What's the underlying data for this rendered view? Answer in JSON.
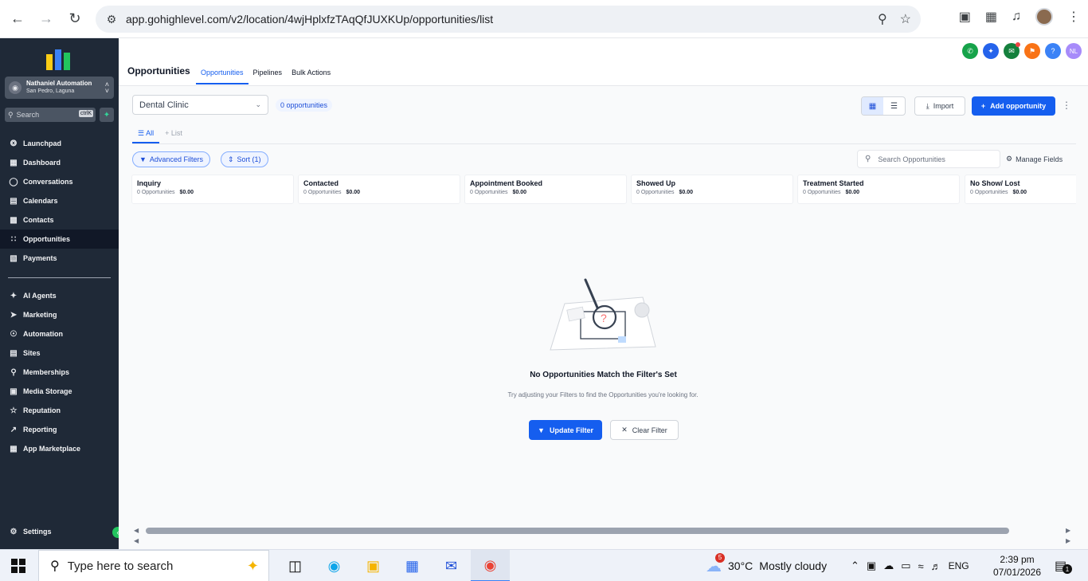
{
  "browser": {
    "url": "app.gohighlevel.com/v2/location/4wjHplxfzTAqQfJUXKUp/opportunities/list",
    "icons": [
      "back-icon",
      "forward-icon",
      "reload-icon",
      "site-settings-icon",
      "zoom-icon",
      "bookmark-star-icon",
      "camera-icon",
      "extensions-icon",
      "media-control-icon",
      "profile-avatar",
      "menu-icon"
    ]
  },
  "sidebar": {
    "account_name": "Nathaniel Automation",
    "account_location": "San Pedro, Laguna",
    "search_placeholder": "Search",
    "search_shortcut": "ctrlK",
    "items": [
      {
        "label": "Launchpad",
        "icon": "rocket-icon"
      },
      {
        "label": "Dashboard",
        "icon": "grid-icon"
      },
      {
        "label": "Conversations",
        "icon": "chat-icon"
      },
      {
        "label": "Calendars",
        "icon": "calendar-icon"
      },
      {
        "label": "Contacts",
        "icon": "contacts-icon"
      },
      {
        "label": "Opportunities",
        "icon": "opportunities-icon"
      },
      {
        "label": "Payments",
        "icon": "payments-icon"
      }
    ],
    "items2": [
      {
        "label": "AI Agents",
        "icon": "sparkle-icon"
      },
      {
        "label": "Marketing",
        "icon": "send-icon"
      },
      {
        "label": "Automation",
        "icon": "automation-icon"
      },
      {
        "label": "Sites",
        "icon": "sites-icon"
      },
      {
        "label": "Memberships",
        "icon": "memberships-icon"
      },
      {
        "label": "Media Storage",
        "icon": "image-icon"
      },
      {
        "label": "Reputation",
        "icon": "star-icon"
      },
      {
        "label": "Reporting",
        "icon": "chart-line-icon"
      },
      {
        "label": "App Marketplace",
        "icon": "apps-icon"
      }
    ],
    "settings_label": "Settings"
  },
  "header": {
    "title": "Opportunities",
    "tabs": [
      "Opportunities",
      "Pipelines",
      "Bulk Actions"
    ],
    "user_initials": "NL"
  },
  "toolbar": {
    "pipeline": "Dental Clinic",
    "count_badge": "0 opportunities",
    "import_label": "Import",
    "add_label": "Add opportunity"
  },
  "subtabs": {
    "all": "All",
    "list": "List"
  },
  "filters": {
    "advanced_label": "Advanced Filters",
    "sort_label": "Sort (1)",
    "search_placeholder": "Search Opportunities",
    "manage_fields_label": "Manage Fields"
  },
  "stages": [
    {
      "name": "Inquiry",
      "count": "0 Opportunities",
      "amount": "$0.00"
    },
    {
      "name": "Contacted",
      "count": "0 Opportunities",
      "amount": "$0.00"
    },
    {
      "name": "Appointment Booked",
      "count": "0 Opportunities",
      "amount": "$0.00"
    },
    {
      "name": "Showed Up",
      "count": "0 Opportunities",
      "amount": "$0.00"
    },
    {
      "name": "Treatment Started",
      "count": "0 Opportunities",
      "amount": "$0.00"
    },
    {
      "name": "No Show/ Lost",
      "count": "0 Opportunities",
      "amount": "$0.00"
    }
  ],
  "empty": {
    "title": "No Opportunities Match the Filter's Set",
    "description": "Try adjusting your Filters to find the Opportunities you're looking for.",
    "update_label": "Update Filter",
    "clear_label": "Clear Filter"
  },
  "taskbar": {
    "search_placeholder": "Type here to search",
    "weather_temp": "30°C",
    "weather_desc": "Mostly cloudy",
    "weather_badge": "5",
    "language": "ENG",
    "time": "2:39 pm",
    "date": "07/01/2026",
    "notification_count": "1"
  },
  "colors": {
    "accent": "#155eef",
    "sidebar": "#1f2937",
    "success": "#22c55e"
  }
}
